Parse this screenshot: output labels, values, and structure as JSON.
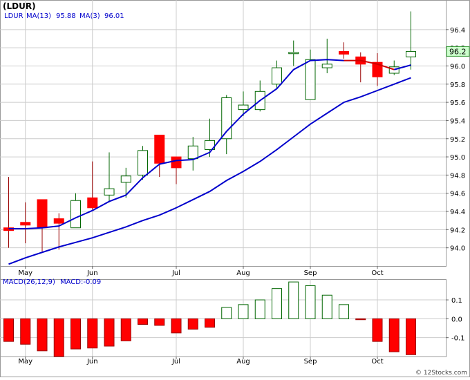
{
  "title": "(LDUR)",
  "price_legend": {
    "symbol": "LDUR",
    "ma13_label": "MA(13)",
    "ma13_value": "95.88",
    "ma3_label": "MA(3)",
    "ma3_value": "96.01"
  },
  "macd_legend": {
    "label": "MACD(26,12,9)",
    "value_text": "MACD:-0.09"
  },
  "last_price_tag": "96.2",
  "watermark": "© 12Stocks.com",
  "colors": {
    "up": "#006600",
    "down": "#ff0000",
    "ma13": "#0000cc",
    "ma3_blue": "#0000cc",
    "ma3_red": "#cc0000",
    "grid": "#cccccc",
    "legend_text": "#0000cc",
    "price_tag_bg": "#ccffcc"
  },
  "chart_data": [
    {
      "type": "candlestick",
      "name": "price",
      "x_tick_labels": [
        "May",
        "Jun",
        "Jul",
        "Aug",
        "Sep",
        "Oct"
      ],
      "y_tick_labels": [
        "94.0",
        "94.2",
        "94.4",
        "94.6",
        "94.8",
        "95.0",
        "95.2",
        "95.4",
        "95.6",
        "95.8",
        "96.0",
        "96.2",
        "96.4"
      ],
      "ylim": [
        93.8,
        96.6
      ],
      "grid": true,
      "candles": [
        {
          "open": 94.22,
          "high": 94.78,
          "low": 94.0,
          "close": 94.19
        },
        {
          "open": 94.28,
          "high": 94.5,
          "low": 94.05,
          "close": 94.25
        },
        {
          "open": 94.53,
          "high": 94.53,
          "low": 93.96,
          "close": 94.22
        },
        {
          "open": 94.32,
          "high": 94.38,
          "low": 93.98,
          "close": 94.27
        },
        {
          "open": 94.22,
          "high": 94.6,
          "low": 94.22,
          "close": 94.52
        },
        {
          "open": 94.55,
          "high": 94.95,
          "low": 94.42,
          "close": 94.44
        },
        {
          "open": 94.58,
          "high": 95.05,
          "low": 94.5,
          "close": 94.65
        },
        {
          "open": 94.72,
          "high": 94.88,
          "low": 94.55,
          "close": 94.79
        },
        {
          "open": 94.8,
          "high": 95.12,
          "low": 94.75,
          "close": 95.07
        },
        {
          "open": 95.24,
          "high": 95.24,
          "low": 94.78,
          "close": 94.93
        },
        {
          "open": 95.0,
          "high": 95.0,
          "low": 94.7,
          "close": 94.88
        },
        {
          "open": 94.98,
          "high": 95.22,
          "low": 94.85,
          "close": 95.12
        },
        {
          "open": 95.08,
          "high": 95.42,
          "low": 95.0,
          "close": 95.18
        },
        {
          "open": 95.2,
          "high": 95.68,
          "low": 95.03,
          "close": 95.65
        },
        {
          "open": 95.52,
          "high": 95.72,
          "low": 95.45,
          "close": 95.57
        },
        {
          "open": 95.52,
          "high": 95.84,
          "low": 95.5,
          "close": 95.72
        },
        {
          "open": 95.8,
          "high": 96.06,
          "low": 95.75,
          "close": 95.98
        },
        {
          "open": 96.14,
          "high": 96.28,
          "low": 96.0,
          "close": 96.15
        },
        {
          "open": 95.63,
          "high": 96.18,
          "low": 95.63,
          "close": 96.07
        },
        {
          "open": 95.98,
          "high": 96.3,
          "low": 95.92,
          "close": 96.02
        },
        {
          "open": 96.16,
          "high": 96.26,
          "low": 96.08,
          "close": 96.13
        },
        {
          "open": 96.1,
          "high": 96.15,
          "low": 95.82,
          "close": 96.02
        },
        {
          "open": 96.04,
          "high": 96.14,
          "low": 95.78,
          "close": 95.88
        },
        {
          "open": 95.92,
          "high": 96.06,
          "low": 95.9,
          "close": 95.99
        },
        {
          "open": 96.1,
          "high": 96.6,
          "low": 95.96,
          "close": 96.16
        }
      ],
      "ma13": [
        93.82,
        93.89,
        93.95,
        94.01,
        94.06,
        94.11,
        94.17,
        94.23,
        94.3,
        94.36,
        94.44,
        94.53,
        94.62,
        94.74,
        94.84,
        94.95,
        95.08,
        95.22,
        95.36,
        95.48,
        95.6,
        95.66,
        95.73,
        95.8,
        95.87
      ],
      "ma3": [
        94.21,
        94.21,
        94.22,
        94.24,
        94.33,
        94.41,
        94.51,
        94.58,
        94.77,
        94.92,
        94.96,
        94.97,
        95.05,
        95.28,
        95.47,
        95.62,
        95.75,
        95.96,
        96.06,
        96.07,
        96.06,
        96.06,
        96.02,
        95.96,
        96.01
      ]
    },
    {
      "type": "bar",
      "name": "MACD(26,12,9)",
      "x_tick_labels": [
        "May",
        "Jun",
        "Jul",
        "Aug",
        "Sep",
        "Oct"
      ],
      "y_tick_labels": [
        "0.1",
        "0.0",
        "-0.1"
      ],
      "ylim": [
        -0.2,
        0.21
      ],
      "values": [
        -0.12,
        -0.135,
        -0.17,
        -0.2,
        -0.16,
        -0.155,
        -0.145,
        -0.117,
        -0.03,
        -0.035,
        -0.075,
        -0.055,
        -0.045,
        0.06,
        0.075,
        0.1,
        0.16,
        0.195,
        0.175,
        0.125,
        0.075,
        -0.005,
        -0.12,
        -0.175,
        -0.19
      ]
    }
  ]
}
